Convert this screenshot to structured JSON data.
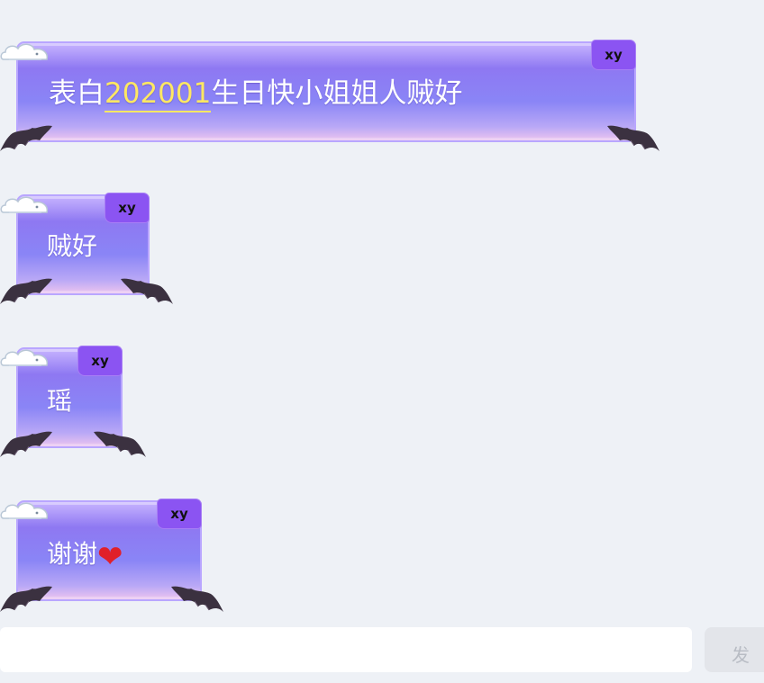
{
  "messages": [
    {
      "prefix": "表白",
      "highlight": "202001",
      "suffix": "生日快小姐姐人贼好",
      "badge": "xy"
    },
    {
      "text": "贼好",
      "badge": "xy"
    },
    {
      "text": "瑶",
      "badge": "xy"
    },
    {
      "text": "谢谢",
      "emoji": "❤",
      "badge": "xy"
    }
  ],
  "composer": {
    "send_label": "发"
  },
  "colors": {
    "bubble_top": "#8e78f2",
    "bubble_bottom": "#ecc4ef",
    "badge": "#8b54f2",
    "highlight": "#ffe862",
    "background": "#eef1f6"
  },
  "icons": [
    "cloud-decoration-icon",
    "bat-wing-icon",
    "heart-emoji-icon"
  ]
}
